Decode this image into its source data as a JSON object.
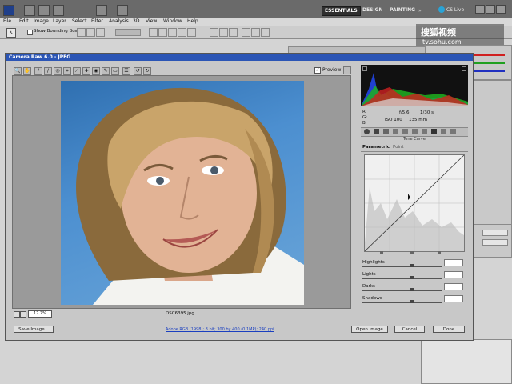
{
  "menu": {
    "items": [
      "File",
      "Edit",
      "Image",
      "Layer",
      "Select",
      "Filter",
      "Analysis",
      "3D",
      "View",
      "Window",
      "Help"
    ]
  },
  "workspace": {
    "essentials": "ESSENTIALS",
    "design": "DESIGN",
    "painting": "PAINTING",
    "cslive": "CS Live"
  },
  "options_bar": {
    "show_bounding_box": "Show Bounding Box"
  },
  "watermark": "tv.sohu.com",
  "camera_raw": {
    "title": "Camera Raw 6.0 - JPEG",
    "preview_label": "Preview",
    "readout_r": "R:",
    "readout_g": "G:",
    "readout_b": "B:",
    "readout_f": "f/5.6",
    "readout_shutter": "1/30 s",
    "readout_iso": "ISO 100",
    "readout_lens": "135 mm",
    "panel_title": "Tone Curve",
    "tab_parametric": "Parametric",
    "tab_point": "Point",
    "sliders": [
      {
        "label": "Highlights"
      },
      {
        "label": "Lights"
      },
      {
        "label": "Darks"
      },
      {
        "label": "Shadows"
      }
    ],
    "zoom": "17.7%",
    "filename": "DSC6395.jpg",
    "workflow_link": "Adobe RGB (1998); 8 bit; 300 by 400 (0.1MP); 240 ppi",
    "save_button": "Save Image...",
    "open_button": "Open Image",
    "cancel_button": "Cancel",
    "done_button": "Done"
  },
  "colors": {
    "titlebar": "#2b55b5",
    "app_bar": "#6a6a6a",
    "dialog_bg": "#c8c8c8"
  }
}
